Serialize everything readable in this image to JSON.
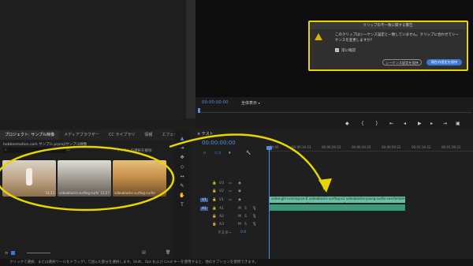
{
  "program_monitor": {
    "timecode": "00:00:00:00",
    "fit_label": "全体表示"
  },
  "warning_dialog": {
    "title": "クリップの不一致に関する警告",
    "message": "このクリップはシーケンス設定と一致していません。クリップに合わせてシーケンスを変更しますか？",
    "checkbox_label": "常に確認",
    "checkbox_checked": true,
    "keep_button": "シーケンス設定を保持",
    "change_button": "現在の設定を保持"
  },
  "project_panel": {
    "tabs": [
      "プロジェクト: サンプル映像",
      "メディアブラウザー",
      "CC ライブラリ",
      "情報",
      "エフェクト"
    ],
    "path": "hobbeemotion.com サンプル.prproj\\サンプル映像",
    "selection_info": "アイテムの選択を解除",
    "thumbnails": [
      {
        "name": "",
        "duration": "18;13"
      },
      {
        "name": "videoblocks-surfing-surfer",
        "duration": "15;27"
      },
      {
        "name": "videoblocks-surfing-surfer",
        "duration": ""
      }
    ]
  },
  "timeline": {
    "tab_label": "テスト",
    "timecode": "00:00:00:00",
    "ruler": [
      "00:00",
      "00:00:14:23",
      "00:00:29:23",
      "00:00:44:22",
      "00:00:59:22",
      "00:01:14:22",
      "00:01:29:21"
    ],
    "video_tracks": [
      "V3",
      "V2",
      "V1"
    ],
    "audio_tracks": [
      "A1",
      "A2",
      "A3"
    ],
    "source_v": "V1",
    "source_a": "A1",
    "master_label": "マスター",
    "master_value": "0.0",
    "clips": [
      "video-girl-running-on-beach",
      "videoblocks-surfing-surf",
      "videoblocks-young-surfer-sea-female-beach"
    ]
  },
  "status_bar": {
    "text": "クリックで選択、または選択ツールをドラッグして囲んだ部分を選択します。Shift、Opt および Cmd キーを使用すると、他のオプションを使用できます。"
  },
  "colors": {
    "annotation": "#e6d600",
    "clip_video": "#6bbfa7",
    "clip_audio": "#3a9a7a",
    "accent_blue": "#3b78d8",
    "playhead": "#4f8fe0"
  }
}
